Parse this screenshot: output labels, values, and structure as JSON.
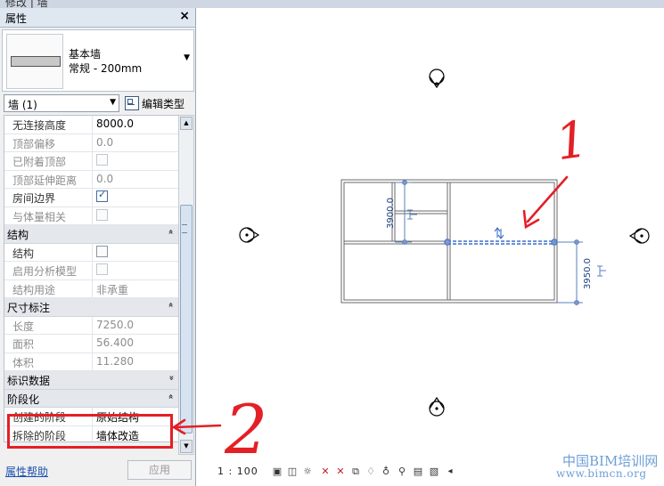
{
  "window": {
    "title_partial": "修改 | 墙"
  },
  "properties": {
    "header_title": "属性",
    "close_glyph": "×",
    "type_selector": {
      "family": "基本墙",
      "type": "常规 - 200mm"
    },
    "filter": {
      "value": "墙 (1)",
      "edit_type_label": "编辑类型"
    },
    "rows": [
      {
        "kind": "prop",
        "label": "无连接高度",
        "value": "8000.0",
        "value_style": "normal",
        "label_style": "normal"
      },
      {
        "kind": "prop",
        "label": "顶部偏移",
        "value": "0.0",
        "value_style": "dim",
        "label_style": "dim"
      },
      {
        "kind": "check",
        "label": "已附着顶部",
        "checked": false,
        "label_style": "dim"
      },
      {
        "kind": "prop",
        "label": "顶部延伸距离",
        "value": "0.0",
        "value_style": "dim",
        "label_style": "dim"
      },
      {
        "kind": "check",
        "label": "房间边界",
        "checked": true,
        "label_style": "normal"
      },
      {
        "kind": "check",
        "label": "与体量相关",
        "checked": false,
        "label_style": "dim"
      },
      {
        "kind": "section",
        "label": "结构",
        "glyph": "»"
      },
      {
        "kind": "check",
        "label": "结构",
        "checked": false,
        "label_style": "normal"
      },
      {
        "kind": "check",
        "label": "启用分析模型",
        "checked": false,
        "label_style": "dim"
      },
      {
        "kind": "prop",
        "label": "结构用途",
        "value": "非承重",
        "value_style": "dim",
        "label_style": "dim"
      },
      {
        "kind": "section",
        "label": "尺寸标注",
        "glyph": "»"
      },
      {
        "kind": "prop",
        "label": "长度",
        "value": "7250.0",
        "value_style": "dim",
        "label_style": "dim"
      },
      {
        "kind": "prop",
        "label": "面积",
        "value": "56.400",
        "value_style": "dim",
        "label_style": "dim"
      },
      {
        "kind": "prop",
        "label": "体积",
        "value": "11.280",
        "value_style": "dim",
        "label_style": "dim"
      },
      {
        "kind": "section",
        "label": "标识数据",
        "glyph": "»"
      },
      {
        "kind": "section",
        "label": "阶段化",
        "glyph": "»"
      },
      {
        "kind": "prop",
        "label": "创建的阶段",
        "value": "原始结构",
        "value_style": "normal",
        "label_style": "normal"
      },
      {
        "kind": "prop",
        "label": "拆除的阶段",
        "value": "墙体改造",
        "value_style": "normal",
        "label_style": "normal"
      }
    ],
    "footer": {
      "help_link": "属性帮助",
      "apply_label": "应用"
    }
  },
  "drawing": {
    "dim_vertical_left": "3900.0",
    "dim_vertical_right": "3950.0",
    "annotation_1": "1",
    "annotation_2": "2"
  },
  "statusbar": {
    "scale": "1 : 100"
  },
  "watermark": {
    "line1": "中国BIM培训网",
    "line2": "www.bimcn.org"
  },
  "colors": {
    "highlight_red": "#e41f26",
    "selection_blue": "#3d6fc9",
    "link_blue": "#1a4fb0"
  }
}
